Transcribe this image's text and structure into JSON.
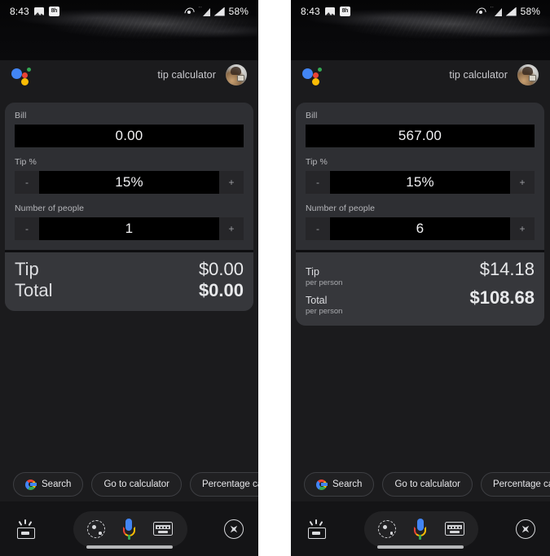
{
  "status_bar": {
    "time": "8:43",
    "battery": "58%",
    "icons": [
      "photo-icon",
      "notification-badge-icon",
      "cast-icon",
      "wifi-icon",
      "signal-icon"
    ]
  },
  "assistant_header": {
    "logo": "google-assistant-logo",
    "title": "tip calculator",
    "avatar": "user-avatar"
  },
  "card": {
    "labels": {
      "bill": "Bill",
      "tip_percent": "Tip %",
      "people": "Number of people"
    },
    "stepper": {
      "minus": "-",
      "plus": "+"
    },
    "results": {
      "tip_label": "Tip",
      "total_label": "Total",
      "per_person_sub": "per person"
    }
  },
  "left_panel": {
    "bill_value": "0.00",
    "tip_percent_value": "15%",
    "people_value": "1",
    "tip_result": "$0.00",
    "total_result": "$0.00",
    "show_per_person": false
  },
  "right_panel": {
    "bill_value": "567.00",
    "tip_percent_value": "15%",
    "people_value": "6",
    "tip_result": "$14.18",
    "total_result": "$108.68",
    "show_per_person": true
  },
  "chips": [
    {
      "label": "Search",
      "icon": "google-g-icon"
    },
    {
      "label": "Go to calculator",
      "icon": null
    },
    {
      "label": "Percentage calc",
      "icon": null
    }
  ],
  "nav_bar": {
    "snapshot": "snapshot-icon",
    "lens": "lens-icon",
    "mic": "google-mic-icon",
    "keyboard": "keyboard-icon",
    "explore": "compass-icon"
  },
  "colors": {
    "google_blue": "#4285F4",
    "google_red": "#EA4335",
    "google_yellow": "#FBBC05",
    "google_green": "#34A853",
    "card_bg": "#2e2f33",
    "result_bg": "#36373b",
    "input_bg": "#000000",
    "screen_bg": "#1b1b1d"
  }
}
